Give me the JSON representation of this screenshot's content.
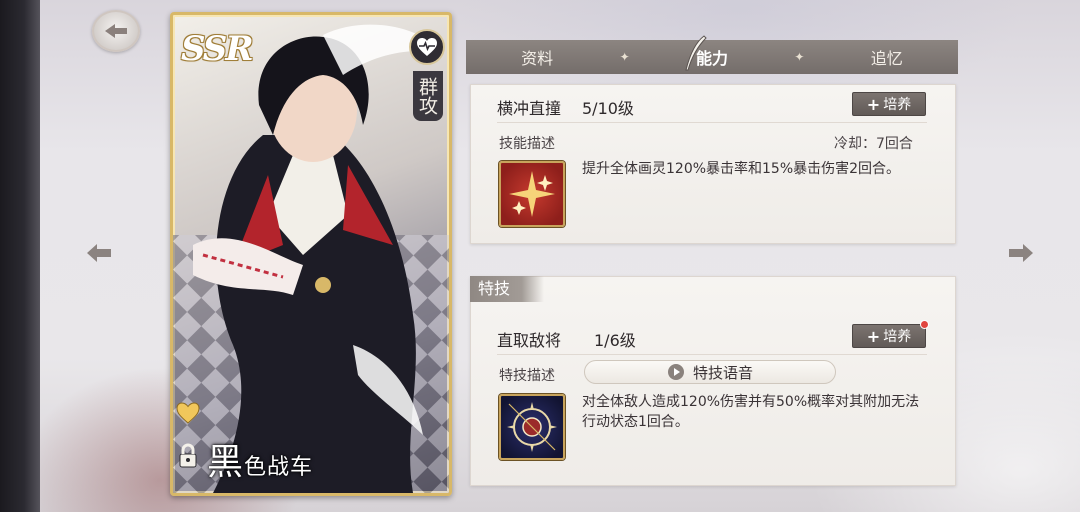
{
  "card": {
    "rarity": "SSR",
    "type": "群攻",
    "name_first": "黑",
    "name_rest": "色战车"
  },
  "tabs": [
    {
      "label": "资料",
      "active": false
    },
    {
      "label": "能力",
      "active": true
    },
    {
      "label": "追忆",
      "active": false
    }
  ],
  "skill": {
    "name": "横冲直撞",
    "level": "5/10级",
    "train_label": "培养",
    "desc_label": "技能描述",
    "cooldown": "冷却：7回合",
    "description": "提升全体画灵120%暴击率和15%暴击伤害2回合。"
  },
  "special": {
    "section_label": "特技",
    "name": "直取敌将",
    "level": "1/6级",
    "train_label": "培养",
    "desc_label": "特技描述",
    "voice_label": "特技语音",
    "description": "对全体敌人造成120%伤害并有50%概率对其附加无法行动状态1回合。"
  },
  "colors": {
    "card_border": "#d8b868",
    "tab_bg": "#746d6a",
    "button_bg": "#615a57",
    "notify_dot": "#e0453e"
  },
  "icons": {
    "back": "back-arrow-icon",
    "prev": "left-arrow-icon",
    "next": "right-arrow-icon",
    "heart": "heart-pulse-icon",
    "favorite": "heart-icon",
    "lock": "lock-icon",
    "play": "play-icon",
    "skill": "sparkle-skill-icon",
    "special": "emblem-skill-icon"
  }
}
